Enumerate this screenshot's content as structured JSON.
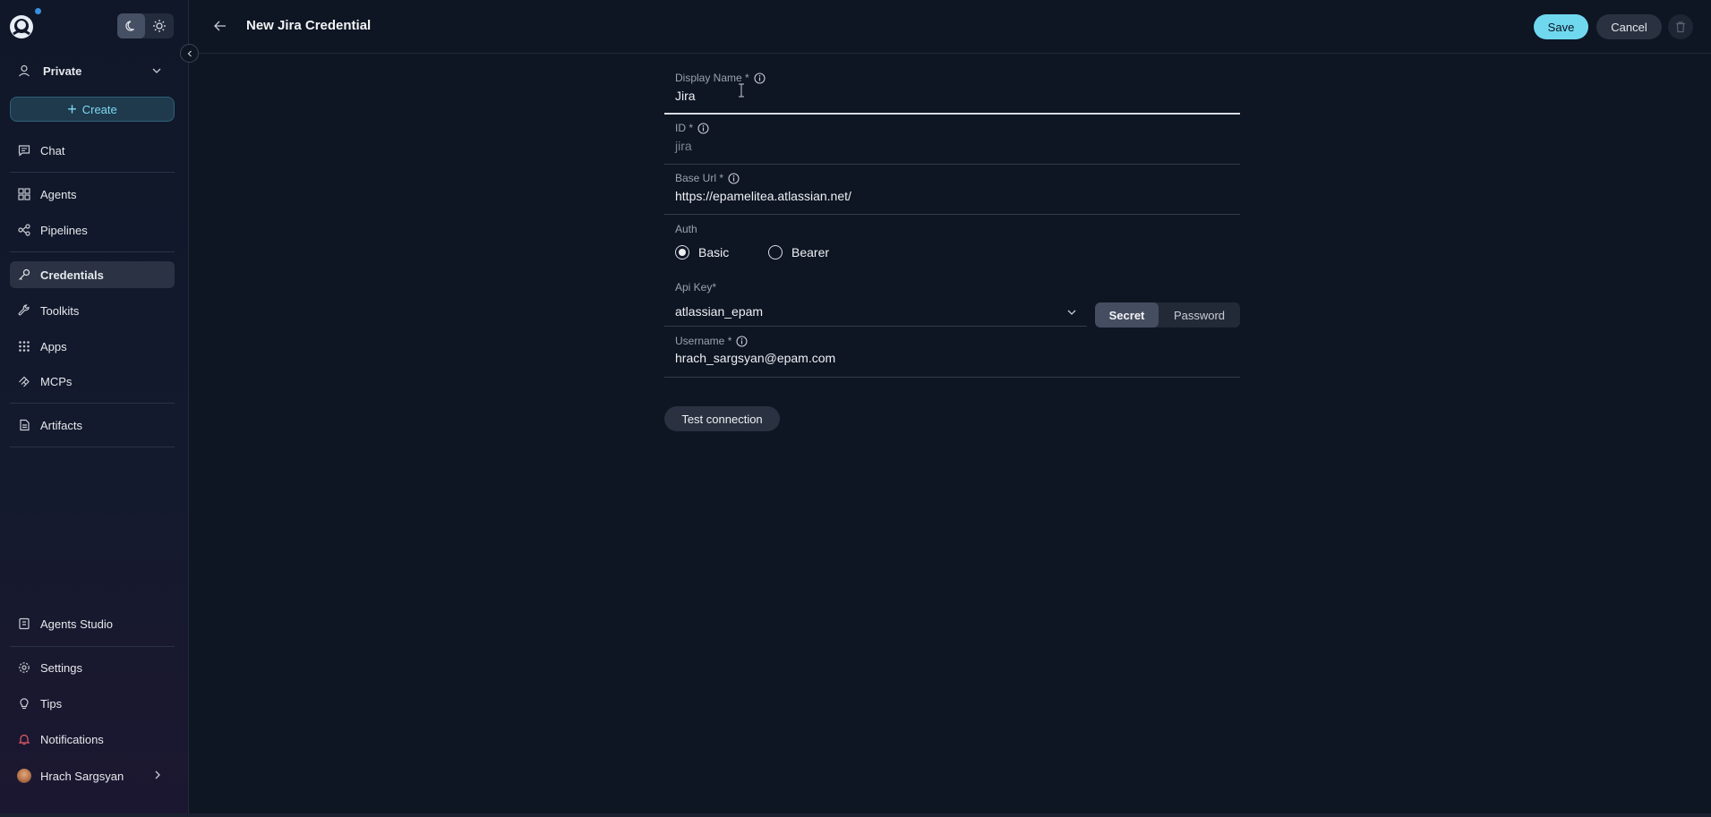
{
  "sidebar": {
    "project": "Private",
    "create_label": "Create",
    "items": [
      {
        "label": "Chat",
        "icon": "chat-icon"
      },
      {
        "label": "Agents",
        "icon": "grid-icon"
      },
      {
        "label": "Pipelines",
        "icon": "pipeline-icon"
      },
      {
        "label": "Credentials",
        "icon": "key-icon",
        "active": true
      },
      {
        "label": "Toolkits",
        "icon": "wrench-icon"
      },
      {
        "label": "Apps",
        "icon": "apps-icon"
      },
      {
        "label": "MCPs",
        "icon": "mcp-icon"
      },
      {
        "label": "Artifacts",
        "icon": "artifact-icon"
      }
    ],
    "bottom_items": [
      {
        "label": "Agents Studio",
        "icon": "studio-icon"
      },
      {
        "label": "Settings",
        "icon": "gear-icon"
      },
      {
        "label": "Tips",
        "icon": "lightbulb-icon"
      },
      {
        "label": "Notifications",
        "icon": "bell-icon"
      }
    ],
    "user": "Hrach Sargsyan"
  },
  "header": {
    "title": "New Jira Credential",
    "save_label": "Save",
    "cancel_label": "Cancel"
  },
  "form": {
    "display_name": {
      "label": "Display Name *",
      "value": "Jira"
    },
    "id": {
      "label": "ID *",
      "value": "jira"
    },
    "base_url": {
      "label": "Base Url *",
      "value": "https://epamelitea.atlassian.net/"
    },
    "auth": {
      "label": "Auth",
      "options": [
        "Basic",
        "Bearer"
      ],
      "selected": "Basic"
    },
    "api_key": {
      "label": "Api Key*",
      "value": "atlassian_epam",
      "modes": [
        "Secret",
        "Password"
      ],
      "selected_mode": "Secret"
    },
    "username": {
      "label": "Username *",
      "value": "hrach_sargsyan@epam.com"
    },
    "test_label": "Test connection"
  },
  "colors": {
    "accent": "#6fd8ef",
    "background": "#0e1523",
    "sidebar": "#0f1728"
  }
}
